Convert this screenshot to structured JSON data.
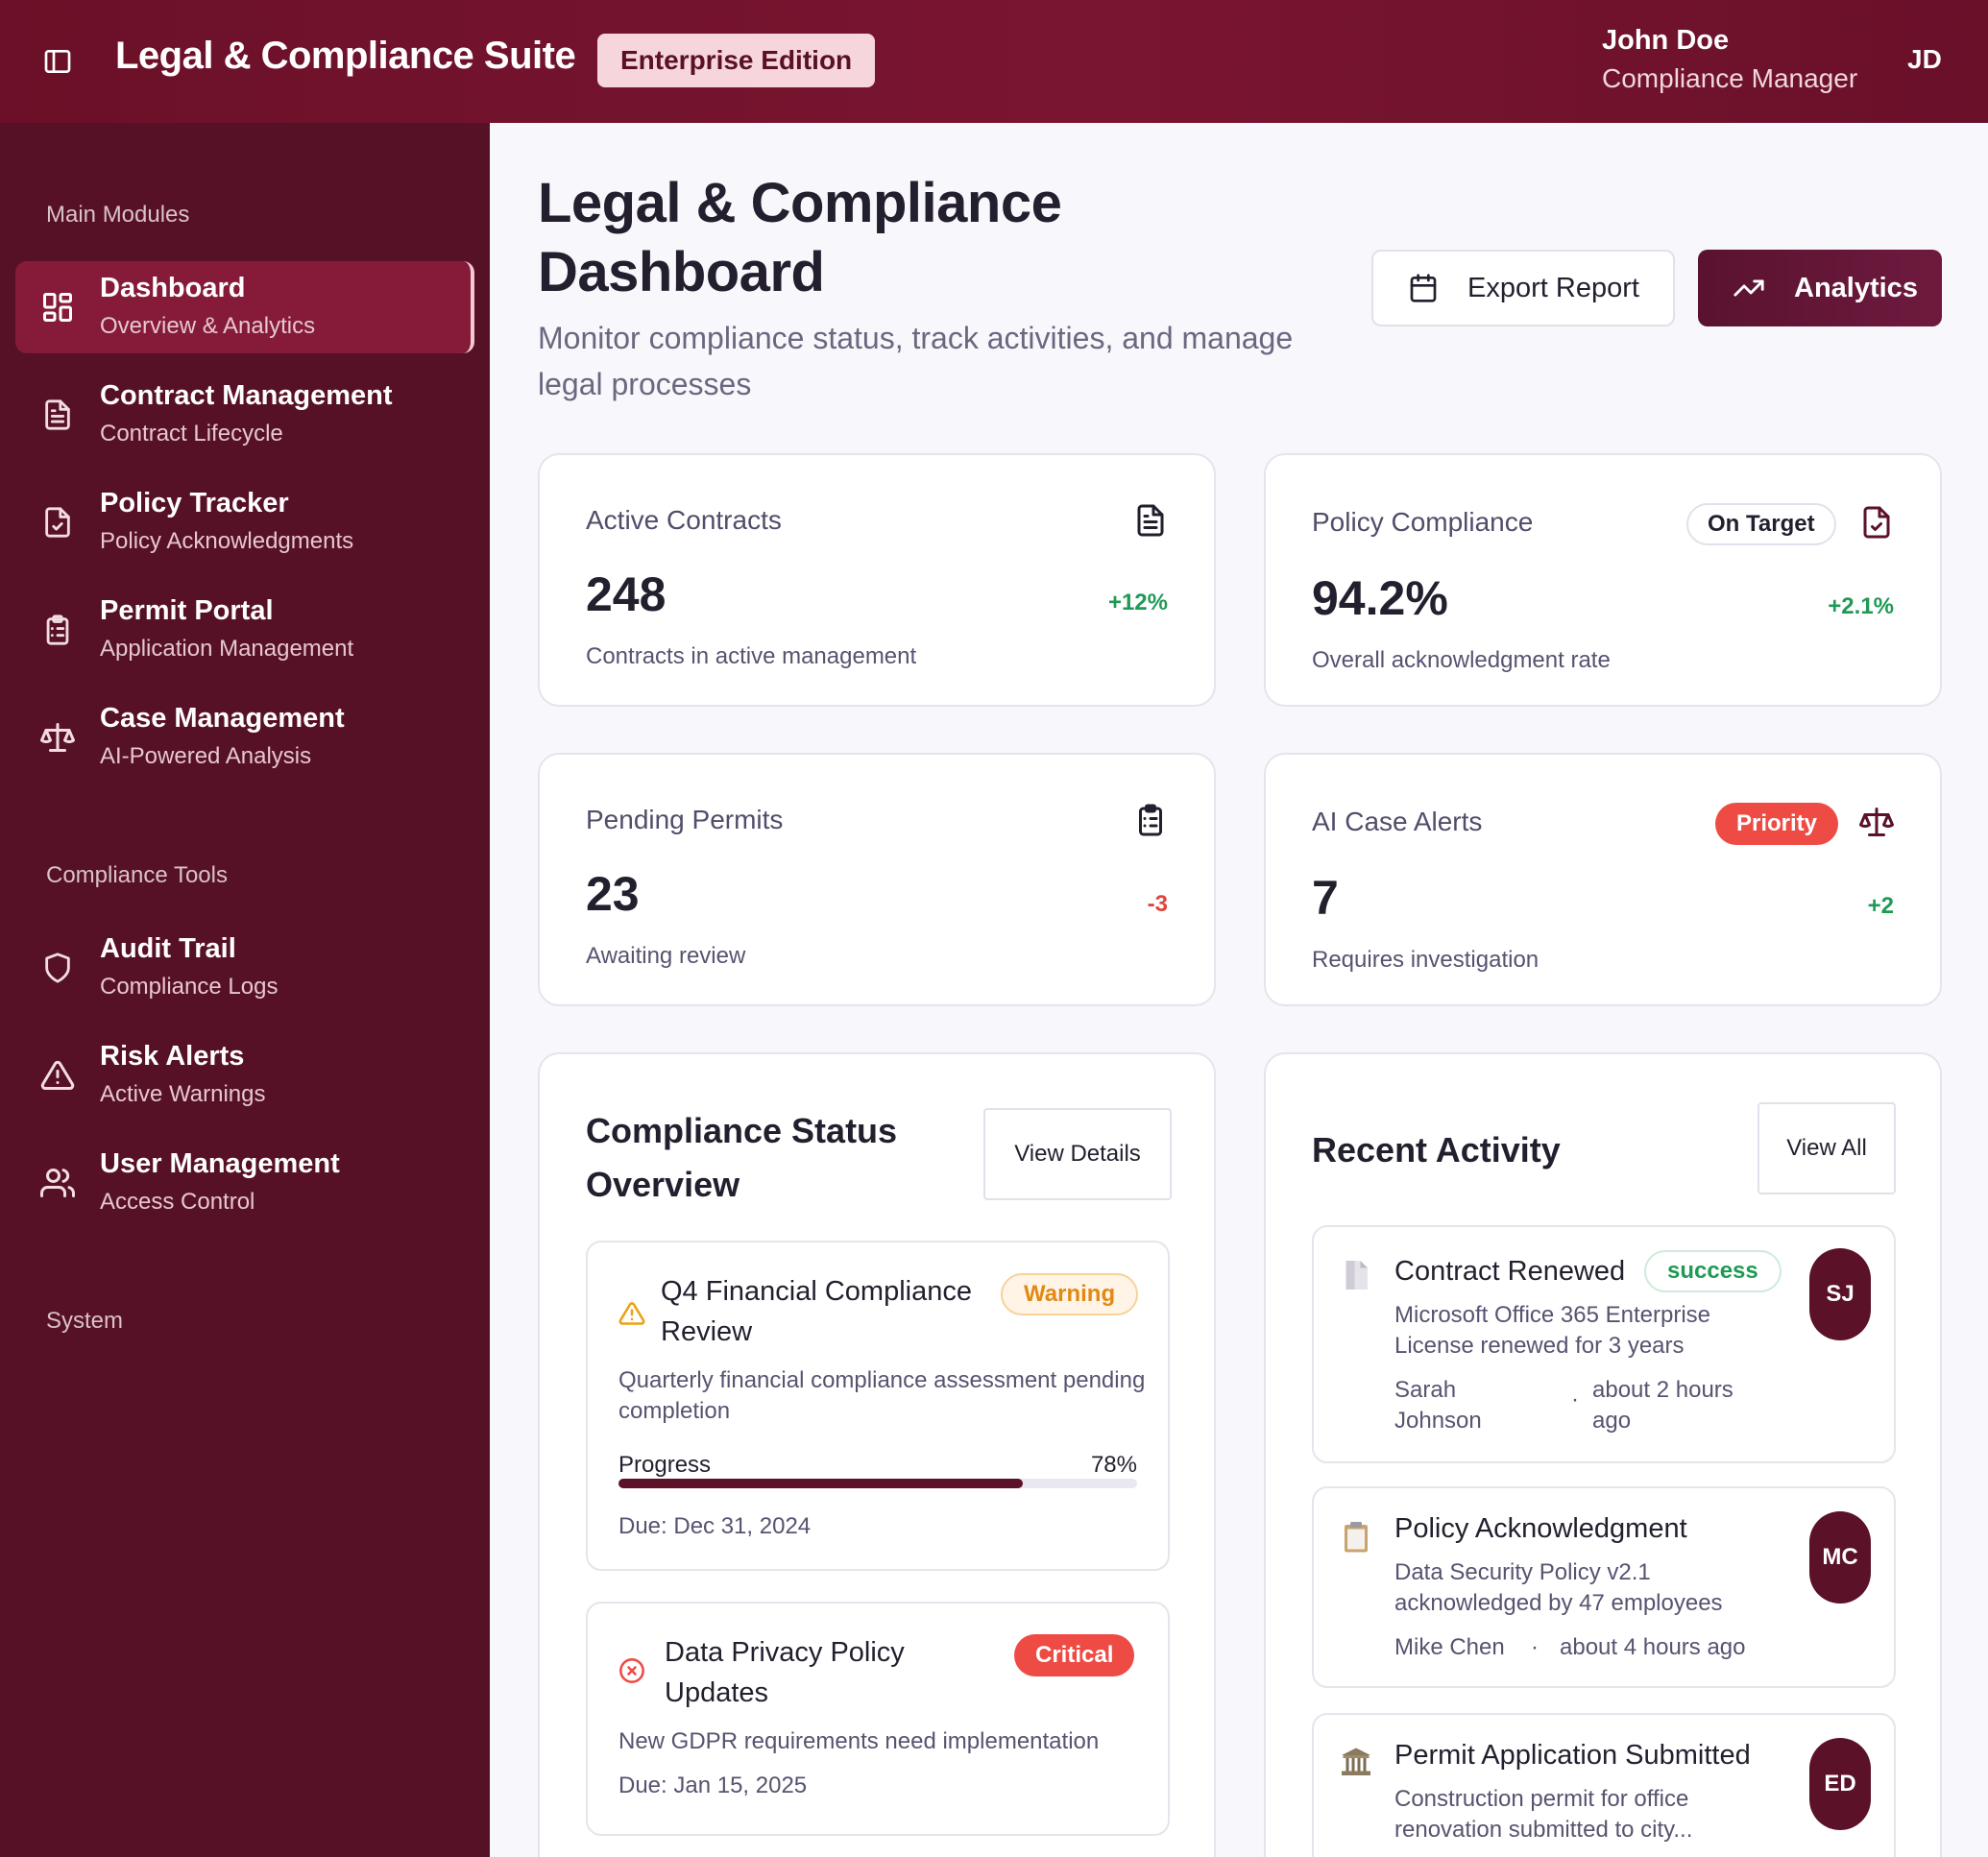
{
  "header": {
    "app_title": "Legal & Compliance Suite",
    "edition": "Enterprise Edition",
    "user_name": "John Doe",
    "user_role": "Compliance Manager",
    "user_initials": "JD"
  },
  "sidebar": {
    "sections": [
      "Main Modules",
      "Compliance Tools",
      "System"
    ],
    "main_items": [
      {
        "title": "Dashboard",
        "subtitle": "Overview & Analytics",
        "icon": "dashboard-grid-icon",
        "active": true
      },
      {
        "title": "Contract Management",
        "subtitle": "Contract Lifecycle",
        "icon": "document-icon"
      },
      {
        "title": "Policy Tracker",
        "subtitle": "Policy Acknowledgments",
        "icon": "file-check-icon"
      },
      {
        "title": "Permit Portal",
        "subtitle": "Application Management",
        "icon": "clipboard-list-icon"
      },
      {
        "title": "Case Management",
        "subtitle": "AI-Powered Analysis",
        "icon": "scale-icon"
      }
    ],
    "tool_items": [
      {
        "title": "Audit Trail",
        "subtitle": "Compliance Logs",
        "icon": "shield-icon"
      },
      {
        "title": "Risk Alerts",
        "subtitle": "Active Warnings",
        "icon": "warning-triangle-icon"
      },
      {
        "title": "User Management",
        "subtitle": "Access Control",
        "icon": "users-icon"
      }
    ]
  },
  "main": {
    "title": "Legal & Compliance Dashboard",
    "subtitle": "Monitor compliance status, track activities, and manage legal processes",
    "export_label": "Export Report",
    "analytics_label": "Analytics"
  },
  "stats": [
    {
      "label": "Active Contracts",
      "value": "248",
      "change": "+12%",
      "description": "Contracts in active management",
      "icon": "document-icon"
    },
    {
      "label": "Policy Compliance",
      "value": "94.2%",
      "change": "+2.1%",
      "description": "Overall acknowledgment rate",
      "badge": "On Target",
      "icon": "file-check-icon"
    },
    {
      "label": "Pending Permits",
      "value": "23",
      "change": "-3",
      "description": "Awaiting review",
      "icon": "clipboard-list-icon"
    },
    {
      "label": "AI Case Alerts",
      "value": "7",
      "change": "+2",
      "description": "Requires investigation",
      "badge": "Priority",
      "icon": "scale-icon"
    }
  ],
  "compliance": {
    "title": "Compliance Status Overview",
    "view_label": "View Details",
    "items": [
      {
        "title": "Q4 Financial Compliance Review",
        "status": "Warning",
        "description": "Quarterly financial compliance assessment pending completion",
        "progress_label": "Progress",
        "progress_text": "78%",
        "progress": 0.78,
        "due": "Due: Dec 31, 2024",
        "icon": "warning-triangle-icon"
      },
      {
        "title": "Data Privacy Policy Updates",
        "status": "Critical",
        "description": "New GDPR requirements need implementation",
        "due": "Due: Jan 15, 2025",
        "icon": "x-circle-icon"
      }
    ]
  },
  "activity": {
    "title": "Recent Activity",
    "view_label": "View All",
    "items": [
      {
        "title": "Contract Renewed",
        "status": "success",
        "description": "Microsoft Office 365 Enterprise License renewed for 3 years",
        "user": "Sarah Johnson",
        "time": "about 2 hours ago",
        "initials": "SJ",
        "icon": "page-icon"
      },
      {
        "title": "Policy Acknowledgment",
        "description": "Data Security Policy v2.1 acknowledged by 47 employees",
        "user": "Mike Chen",
        "time": "about 4 hours ago",
        "initials": "MC",
        "icon": "clipboard-icon"
      },
      {
        "title": "Permit Application Submitted",
        "description": "Construction permit for office renovation submitted to city...",
        "initials": "ED",
        "icon": "building-icon"
      }
    ]
  },
  "colors": {
    "header_bg": "#6b1028",
    "sidebar_bg": "#561126",
    "accent": "#5b1128",
    "success": "#1f9a55",
    "danger": "#ef4b45",
    "warning": "#e08a13"
  }
}
